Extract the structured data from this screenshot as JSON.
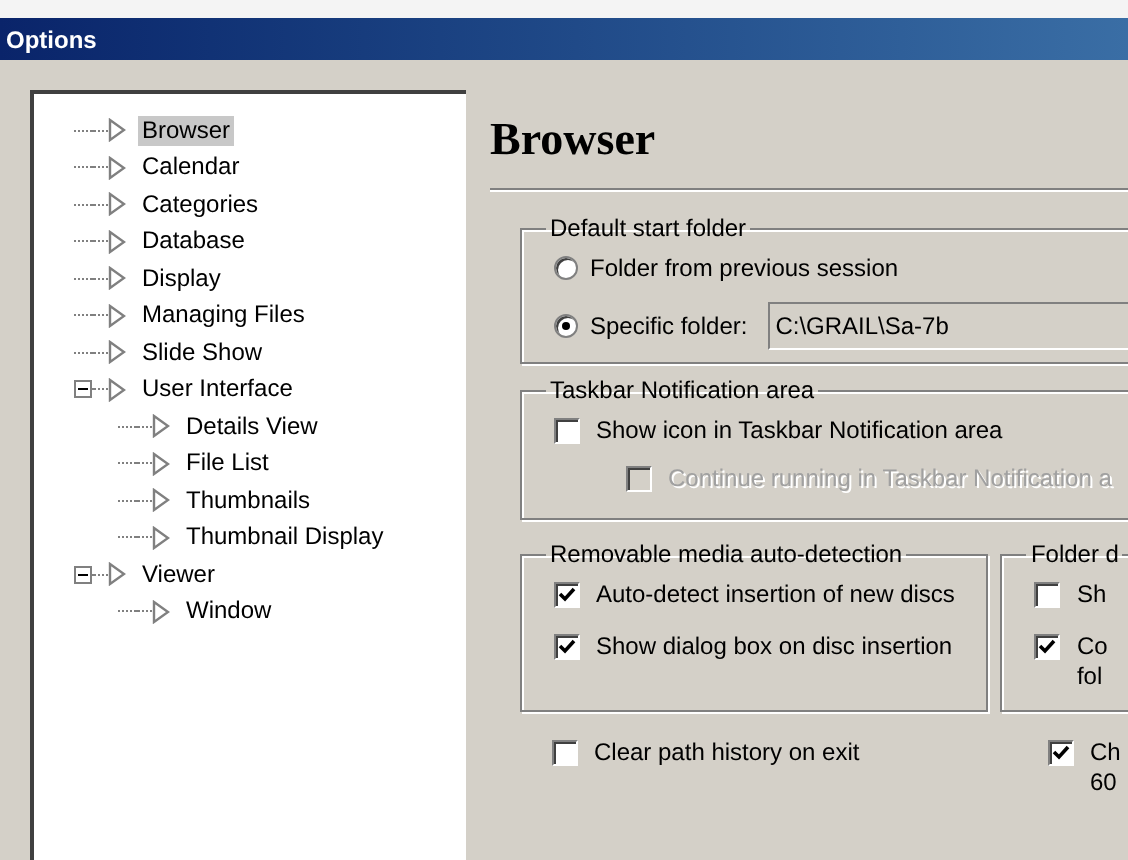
{
  "window": {
    "title": "Options"
  },
  "tree": [
    {
      "label": "Browser",
      "selected": true
    },
    {
      "label": "Calendar",
      "selected": false
    },
    {
      "label": "Categories",
      "selected": false
    },
    {
      "label": "Database",
      "selected": false
    },
    {
      "label": "Display",
      "selected": false
    },
    {
      "label": "Managing Files",
      "selected": false
    },
    {
      "label": "Slide Show",
      "selected": false
    },
    {
      "label": "User Interface",
      "selected": false,
      "expanded": true,
      "children": [
        {
          "label": "Details View",
          "selected": false
        },
        {
          "label": "File List",
          "selected": false
        },
        {
          "label": "Thumbnails",
          "selected": false
        },
        {
          "label": "Thumbnail Display",
          "selected": false
        }
      ]
    },
    {
      "label": "Viewer",
      "selected": false,
      "expanded": true,
      "children": [
        {
          "label": "Window",
          "selected": false
        }
      ]
    }
  ],
  "page": {
    "heading": "Browser",
    "start_folder": {
      "title": "Default start folder",
      "options": [
        {
          "label": "Folder from previous session",
          "selected": false
        },
        {
          "label": "Specific folder:",
          "selected": true
        }
      ],
      "path": "C:\\GRAIL\\Sa-7b"
    },
    "taskbar": {
      "title": "Taskbar Notification area",
      "items": [
        {
          "label": "Show icon in Taskbar Notification area",
          "checked": false,
          "disabled": false
        },
        {
          "label": "Continue running in Taskbar Notification a",
          "checked": false,
          "disabled": true
        }
      ]
    },
    "removable": {
      "title": "Removable media auto-detection",
      "items": [
        {
          "label": "Auto-detect insertion of new discs",
          "checked": true,
          "disabled": false
        },
        {
          "label": "Show dialog box on disc insertion",
          "checked": true,
          "disabled": false
        }
      ]
    },
    "folder": {
      "title": "Folder d",
      "items": [
        {
          "label": "Sh",
          "checked": false,
          "disabled": false
        },
        {
          "label": "Co\nfol",
          "checked": true,
          "disabled": false
        }
      ]
    },
    "bottom": [
      {
        "label": "Clear path history on exit",
        "checked": false,
        "disabled": false
      },
      {
        "label": "Ch\n60",
        "checked": true,
        "disabled": false
      }
    ]
  }
}
